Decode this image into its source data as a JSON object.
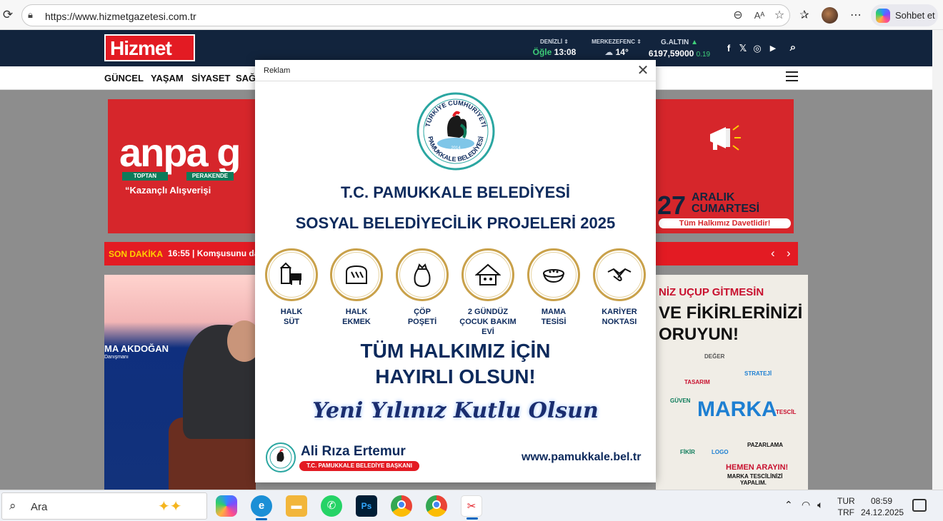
{
  "browser": {
    "url": "https://www.hizmetgazetesi.com.tr",
    "copilot_label": "Sohbet et"
  },
  "site": {
    "logo": "Hizmet",
    "widgets": [
      {
        "label": "DENİZLİ",
        "value_prefix": "Öğle",
        "value": "13:08"
      },
      {
        "label": "MERKEZEFENC",
        "value": "14°"
      },
      {
        "label": "G.ALTIN",
        "value": "6197,59000",
        "change": "0.19"
      }
    ],
    "nav": [
      "GÜNCEL",
      "YAŞAM",
      "SİYASET",
      "SAĞ"
    ]
  },
  "ads": {
    "left_brand": "anpa g",
    "left_tags": [
      "TOPTAN",
      "PERAKENDE"
    ],
    "left_slogan": "“Kazançlı Alışverişi",
    "right_day": "27",
    "right_month_line1": "ARALIK",
    "right_month_line2": "CUMARTESİ",
    "right_invite": "Tüm Halkımız Davetlidir!"
  },
  "ticker": {
    "label": "SON DAKİKA",
    "item": "16:55 | Komşusunu da"
  },
  "news_left": {
    "name": "MA AKDOĞAN",
    "role": "Danışmanı"
  },
  "news_right": {
    "line1": "NİZ UÇUP GİTMESİN",
    "line2": "VE FİKİRLERİNİZİ",
    "line3": "ORUYUN!",
    "center": "MARKA",
    "keywords": [
      "DEĞER",
      "STRATEJİ",
      "TASARIM",
      "GÜVEN",
      "TESCİL",
      "FİKİR",
      "PAZARLAMA",
      "LOGO"
    ],
    "call1": "HEMEN ARAYIN!",
    "call2_line1": "MARKA TESCİLİNİZİ",
    "call2_line2": "YAPALIM."
  },
  "modal": {
    "title": "Reklam",
    "seal_top": "TÜRKİYE CUMHURİYETİ",
    "seal_bottom": "PAMUKKALE BELEDİYESİ",
    "seal_year": "2014",
    "heading1": "T.C. PAMUKKALE BELEDİYESİ",
    "heading2": "SOSYAL BELEDİYECİLİK PROJELERİ 2025",
    "services": [
      {
        "line1": "HALK",
        "line2": "SÜT",
        "icon": "milk-icon"
      },
      {
        "line1": "HALK",
        "line2": "EKMEK",
        "icon": "bread-icon"
      },
      {
        "line1": "ÇÖP",
        "line2": "POŞETİ",
        "icon": "garbage-bag-icon"
      },
      {
        "line1": "2 GÜNDÜZ",
        "line2": "ÇOCUK BAKIM EVİ",
        "icon": "house-icon"
      },
      {
        "line1": "MAMA",
        "line2": "TESİSİ",
        "icon": "pet-food-icon"
      },
      {
        "line1": "KARİYER",
        "line2": "NOKTASI",
        "icon": "handshake-icon"
      }
    ],
    "message1": "TÜM HALKIMIZ İÇİN",
    "message2": "HAYIRLI OLSUN!",
    "greeting": "Yeni Yılınız Kutlu Olsun",
    "mayor_name": "Ali Rıza Ertemur",
    "mayor_title": "T.C. PAMUKKALE BELEDİYE BAŞKANI",
    "url": "www.pamukkale.bel.tr"
  },
  "taskbar": {
    "search_placeholder": "Ara",
    "lang_line1": "TUR",
    "lang_line2": "TRF",
    "time": "08:59",
    "date": "24.12.2025"
  },
  "colors": {
    "header_navy": "#12243d",
    "brand_red": "#e31b23",
    "ad_navy": "#0d2a5c",
    "ring_gold": "#c9a14a"
  }
}
